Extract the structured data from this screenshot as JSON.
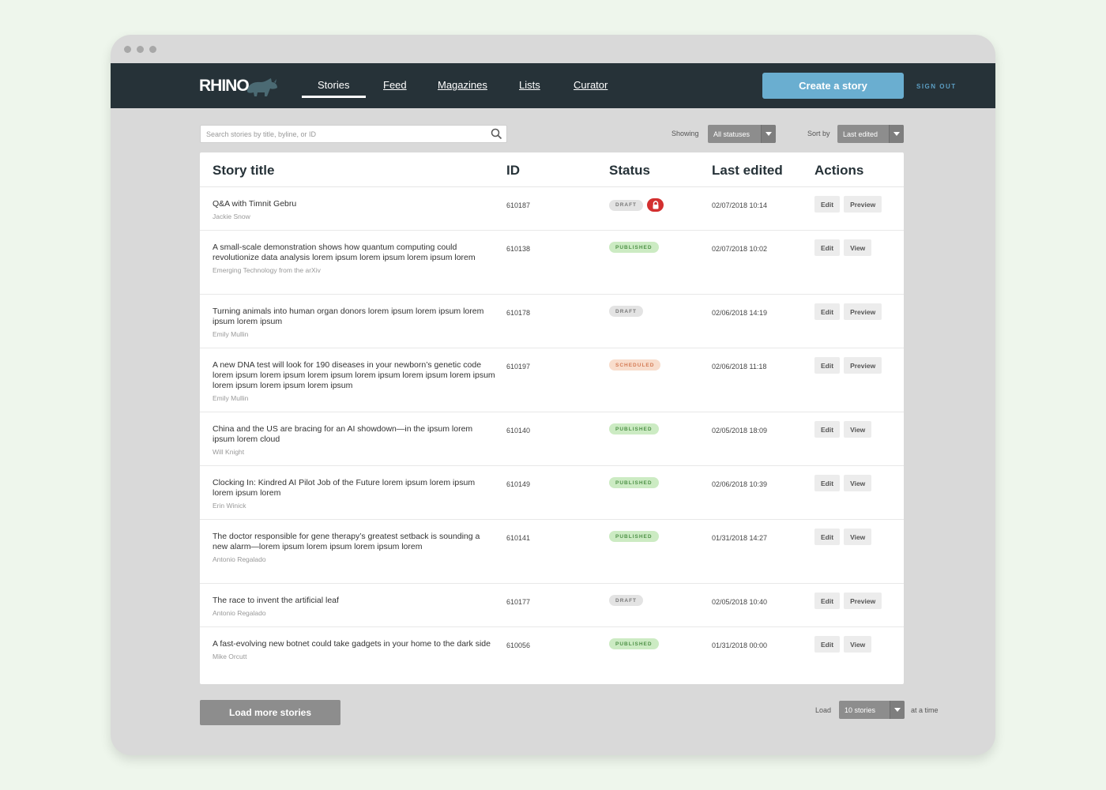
{
  "window": {
    "controls": [
      "dot",
      "dot",
      "dot"
    ]
  },
  "header": {
    "logo": "RHINO",
    "nav": [
      {
        "label": "Stories",
        "active": true
      },
      {
        "label": "Feed",
        "active": false
      },
      {
        "label": "Magazines",
        "active": false
      },
      {
        "label": "Lists",
        "active": false
      },
      {
        "label": "Curator",
        "active": false
      }
    ],
    "create_label": "Create a story",
    "signout_label": "SIGN OUT"
  },
  "filters": {
    "search_placeholder": "Search stories by title, byline, or ID",
    "showing_label": "Showing",
    "showing_value": "All statuses",
    "sort_label": "Sort by",
    "sort_value": "Last edited"
  },
  "table": {
    "columns": [
      "Story title",
      "ID",
      "Status",
      "Last edited",
      "Actions"
    ],
    "rows": [
      {
        "title": "Q&A with Timnit Gebru",
        "byline": "Jackie Snow",
        "id": "610187",
        "status": "DRAFT",
        "status_type": "draft",
        "locked": true,
        "edited": "02/07/2018 10:14",
        "actions": [
          "Edit",
          "Preview"
        ]
      },
      {
        "title": "A small-scale demonstration shows how quantum computing could revolutionize data analysis lorem ipsum lorem ipsum lorem ipsum lorem",
        "byline": "Emerging Technology from the arXiv",
        "id": "610138",
        "status": "PUBLISHED",
        "status_type": "published",
        "locked": false,
        "edited": "02/07/2018 10:02",
        "actions": [
          "Edit",
          "View"
        ]
      },
      {
        "title": "Turning animals into human organ donors lorem ipsum lorem ipsum lorem ipsum lorem ipsum",
        "byline": "Emily Mullin",
        "id": "610178",
        "status": "DRAFT",
        "status_type": "draft",
        "locked": false,
        "edited": "02/06/2018 14:19",
        "actions": [
          "Edit",
          "Preview"
        ]
      },
      {
        "title": "A new DNA test will look for 190 diseases in your newborn’s genetic code lorem ipsum lorem ipsum lorem ipsum lorem ipsum lorem ipsum lorem ipsum lorem ipsum lorem ipsum lorem ipsum",
        "byline": "Emily Mullin",
        "id": "610197",
        "status": "SCHEDULED",
        "status_type": "scheduled",
        "locked": false,
        "edited": "02/06/2018 11:18",
        "actions": [
          "Edit",
          "Preview"
        ]
      },
      {
        "title": "China and the US are bracing for an AI showdown—in the ipsum lorem ipsum lorem cloud",
        "byline": "Will Knight",
        "id": "610140",
        "status": "PUBLISHED",
        "status_type": "published",
        "locked": false,
        "edited": "02/05/2018 18:09",
        "actions": [
          "Edit",
          "View"
        ]
      },
      {
        "title": "Clocking In: Kindred AI Pilot Job of the Future lorem ipsum lorem ipsum lorem ipsum lorem",
        "byline": "Erin Winick",
        "id": "610149",
        "status": "PUBLISHED",
        "status_type": "published",
        "locked": false,
        "edited": "02/06/2018 10:39",
        "actions": [
          "Edit",
          "View"
        ]
      },
      {
        "title": "The doctor responsible for gene therapy’s greatest setback is sounding a new alarm—lorem ipsum lorem ipsum lorem ipsum lorem",
        "byline": "Antonio Regalado",
        "id": "610141",
        "status": "PUBLISHED",
        "status_type": "published",
        "locked": false,
        "edited": "01/31/2018 14:27",
        "actions": [
          "Edit",
          "View"
        ]
      },
      {
        "title": "The race to invent the artificial leaf",
        "byline": "Antonio Regalado",
        "id": "610177",
        "status": "DRAFT",
        "status_type": "draft",
        "locked": false,
        "edited": "02/05/2018 10:40",
        "actions": [
          "Edit",
          "Preview"
        ]
      },
      {
        "title": "A fast-evolving new botnet could take gadgets in your home to the dark side",
        "byline": "Mike Orcutt",
        "id": "610056",
        "status": "PUBLISHED",
        "status_type": "published",
        "locked": false,
        "edited": "01/31/2018 00:00",
        "actions": [
          "Edit",
          "View"
        ]
      }
    ]
  },
  "footer": {
    "load_more_label": "Load more stories",
    "load_label": "Load",
    "load_value": "10 stories",
    "at_a_time_label": "at a time"
  },
  "colors": {
    "navbar": "#263238",
    "accent": "#6aaed0",
    "draft": "#e3e3e3",
    "published": "#ccebc3",
    "scheduled": "#f8ddcc",
    "lock": "#d32f2f"
  },
  "icons": {
    "search": "search-icon",
    "caret": "chevron-down-icon",
    "lock": "lock-icon",
    "logo": "rhino-icon"
  }
}
